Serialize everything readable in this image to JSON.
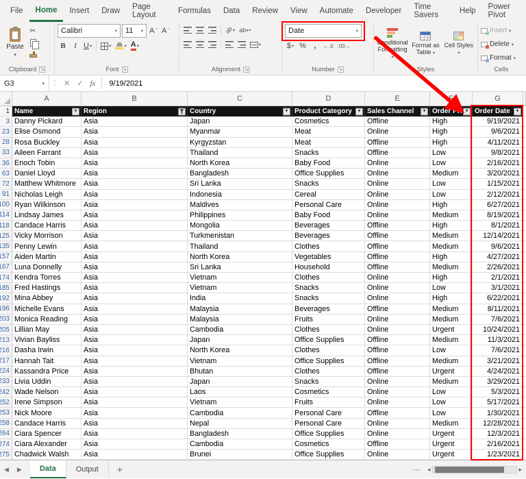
{
  "menu": {
    "tabs": [
      {
        "label": "File"
      },
      {
        "label": "Home",
        "active": true
      },
      {
        "label": "Insert"
      },
      {
        "label": "Draw"
      },
      {
        "label": "Page Layout"
      },
      {
        "label": "Formulas"
      },
      {
        "label": "Data"
      },
      {
        "label": "Review"
      },
      {
        "label": "View"
      },
      {
        "label": "Automate"
      },
      {
        "label": "Developer"
      },
      {
        "label": "Time Savers"
      },
      {
        "label": "Help"
      },
      {
        "label": "Power Pivot"
      }
    ]
  },
  "ribbon": {
    "clipboard": {
      "label": "Clipboard",
      "paste": "Paste"
    },
    "font": {
      "label": "Font",
      "name": "Calibri",
      "size": "11",
      "bold": "B",
      "italic": "I",
      "underline": "U"
    },
    "alignment": {
      "label": "Alignment"
    },
    "number": {
      "label": "Number",
      "format": "Date",
      "currency": "$",
      "percent": "%",
      "comma": ","
    },
    "styles": {
      "label": "Styles",
      "conditional": "Conditional Formatting",
      "table": "Format as Table",
      "cellstyles": "Cell Styles"
    },
    "cells": {
      "label": "Cells",
      "insert": "Insert",
      "delete": "Delete",
      "format": "Format"
    }
  },
  "formula_bar": {
    "name_box": "G3",
    "fx": "fx",
    "value": "9/19/2021"
  },
  "sheet": {
    "column_letters": [
      "A",
      "B",
      "C",
      "D",
      "E",
      "F",
      "G"
    ],
    "headers": [
      "Name",
      "Region",
      "Country",
      "Product Category",
      "Sales Channel",
      "Order Priority",
      "Order Date"
    ],
    "filtered_column": "Region",
    "first_row_number": "1",
    "rows": [
      [
        3,
        "Danny Pickard",
        "Asia",
        "Japan",
        "Cosmetics",
        "Offline",
        "High",
        "9/19/2021"
      ],
      [
        23,
        "Elise Osmond",
        "Asia",
        "Myanmar",
        "Meat",
        "Online",
        "High",
        "9/6/2021"
      ],
      [
        28,
        "Rosa Buckley",
        "Asia",
        "Kyrgyzstan",
        "Meat",
        "Offline",
        "High",
        "4/11/2021"
      ],
      [
        33,
        "Aileen Farrant",
        "Asia",
        "Thailand",
        "Snacks",
        "Offline",
        "Low",
        "9/8/2021"
      ],
      [
        36,
        "Enoch Tobin",
        "Asia",
        "North Korea",
        "Baby Food",
        "Online",
        "Low",
        "2/16/2021"
      ],
      [
        63,
        "Daniel Lloyd",
        "Asia",
        "Bangladesh",
        "Office Supplies",
        "Online",
        "Medium",
        "3/20/2021"
      ],
      [
        72,
        "Matthew Whitmore",
        "Asia",
        "Sri Lanka",
        "Snacks",
        "Online",
        "Low",
        "1/15/2021"
      ],
      [
        91,
        "Nicholas Leigh",
        "Asia",
        "Indonesia",
        "Cereal",
        "Online",
        "Low",
        "2/12/2021"
      ],
      [
        100,
        "Ryan Wilkinson",
        "Asia",
        "Maldives",
        "Personal Care",
        "Online",
        "High",
        "6/27/2021"
      ],
      [
        114,
        "Lindsay James",
        "Asia",
        "Philippines",
        "Baby Food",
        "Online",
        "Medium",
        "8/19/2021"
      ],
      [
        118,
        "Candace Harris",
        "Asia",
        "Mongolia",
        "Beverages",
        "Offline",
        "High",
        "8/1/2021"
      ],
      [
        125,
        "Vicky Morrison",
        "Asia",
        "Turkmenistan",
        "Beverages",
        "Offline",
        "Medium",
        "12/14/2021"
      ],
      [
        135,
        "Penny Lewin",
        "Asia",
        "Thailand",
        "Clothes",
        "Offline",
        "Medium",
        "9/6/2021"
      ],
      [
        157,
        "Aiden Martin",
        "Asia",
        "North Korea",
        "Vegetables",
        "Offline",
        "High",
        "4/27/2021"
      ],
      [
        167,
        "Luna Donnelly",
        "Asia",
        "Sri Lanka",
        "Household",
        "Offline",
        "Medium",
        "2/26/2021"
      ],
      [
        174,
        "Kendra Torres",
        "Asia",
        "Vietnam",
        "Clothes",
        "Online",
        "High",
        "2/1/2021"
      ],
      [
        185,
        "Fred Hastings",
        "Asia",
        "Vietnam",
        "Snacks",
        "Online",
        "Low",
        "3/1/2021"
      ],
      [
        192,
        "Mina Abbey",
        "Asia",
        "India",
        "Snacks",
        "Online",
        "High",
        "6/22/2021"
      ],
      [
        196,
        "Michelle Evans",
        "Asia",
        "Malaysia",
        "Beverages",
        "Offline",
        "Medium",
        "8/11/2021"
      ],
      [
        203,
        "Monica Reading",
        "Asia",
        "Malaysia",
        "Fruits",
        "Online",
        "Medium",
        "7/6/2021"
      ],
      [
        205,
        "Lillian May",
        "Asia",
        "Cambodia",
        "Clothes",
        "Online",
        "Urgent",
        "10/24/2021"
      ],
      [
        213,
        "Vivian Bayliss",
        "Asia",
        "Japan",
        "Office Supplies",
        "Offline",
        "Medium",
        "11/3/2021"
      ],
      [
        216,
        "Dasha Irwin",
        "Asia",
        "North Korea",
        "Clothes",
        "Offline",
        "Low",
        "7/6/2021"
      ],
      [
        217,
        "Hannah Tait",
        "Asia",
        "Vietnam",
        "Office Supplies",
        "Offline",
        "Medium",
        "3/21/2021"
      ],
      [
        224,
        "Kassandra Price",
        "Asia",
        "Bhutan",
        "Clothes",
        "Offline",
        "Urgent",
        "4/24/2021"
      ],
      [
        233,
        "Livia Uddin",
        "Asia",
        "Japan",
        "Snacks",
        "Online",
        "Medium",
        "3/29/2021"
      ],
      [
        242,
        "Wade Nelson",
        "Asia",
        "Laos",
        "Cosmetics",
        "Online",
        "Low",
        "5/3/2021"
      ],
      [
        252,
        "Irene Simpson",
        "Asia",
        "Vietnam",
        "Fruits",
        "Online",
        "Low",
        "5/17/2021"
      ],
      [
        253,
        "Nick Moore",
        "Asia",
        "Cambodia",
        "Personal Care",
        "Offline",
        "Low",
        "1/30/2021"
      ],
      [
        258,
        "Candace Harris",
        "Asia",
        "Nepal",
        "Personal Care",
        "Online",
        "Medium",
        "12/28/2021"
      ],
      [
        264,
        "Ciara Spencer",
        "Asia",
        "Bangladesh",
        "Office Supplies",
        "Online",
        "Urgent",
        "12/3/2021"
      ],
      [
        274,
        "Ciara Alexander",
        "Asia",
        "Cambodia",
        "Cosmetics",
        "Offline",
        "Urgent",
        "2/16/2021"
      ],
      [
        275,
        "Chadwick Walsh",
        "Asia",
        "Brunei",
        "Office Supplies",
        "Online",
        "Urgent",
        "1/23/2021"
      ]
    ]
  },
  "tabs_bar": {
    "sheets": [
      {
        "label": "Data",
        "active": true
      },
      {
        "label": "Output"
      }
    ],
    "add": "+"
  },
  "annotation": {
    "color": "#FF0000",
    "highlight_format": "Date",
    "highlight_column": "Order Date"
  },
  "accent": {
    "excel_green": "#217346"
  }
}
